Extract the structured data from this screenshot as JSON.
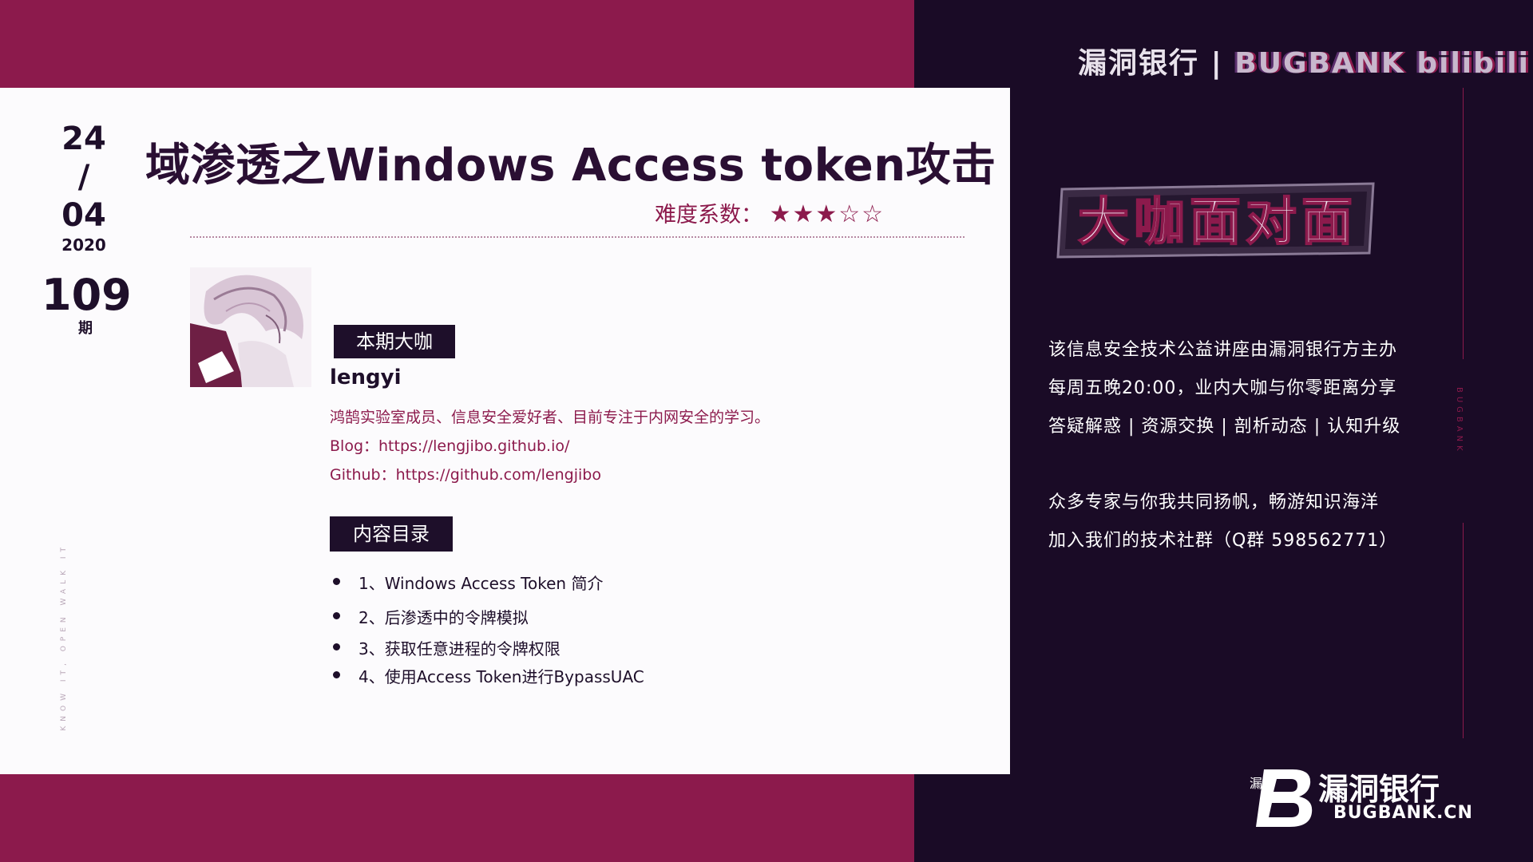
{
  "date": {
    "day": "24",
    "sep": "/",
    "month": "04",
    "year": "2020"
  },
  "issue": {
    "number": "109",
    "suffix": "期"
  },
  "title": "域渗透之Windows Access token攻击",
  "difficulty": {
    "label": "难度系数：",
    "stars": "★★★☆☆",
    "rating": 3,
    "max": 5
  },
  "speaker": {
    "tag": "本期大咖",
    "name": "lengyi",
    "description": "鸿鹄实验室成员、信息安全爱好者、目前专注于内网安全的学习。",
    "blog": "Blog：https://lengjibo.github.io/",
    "github": "Github：https://github.com/lengjibo"
  },
  "toc": {
    "tag": "内容目录",
    "items": [
      "1、Windows Access Token 简介",
      "2、后渗透中的令牌模拟",
      "3、获取任意进程的令牌权限",
      "4、使用Access Token进行BypassUAC"
    ]
  },
  "side_vertical_text": "KNOW IT, OPEN WALK IT",
  "header": {
    "brand_cn": "漏洞银行",
    "divider": "|",
    "brand_en": "BUGBANK",
    "extra": "bilibili"
  },
  "logo_text": "大咖面对面",
  "vertical_brand": "BUGBANK",
  "promo": {
    "line1": "该信息安全技术公益讲座由漏洞银行方主办",
    "line2": "每周五晚20:00，业内大咖与你零距离分享",
    "line3": "答疑解惑 | 资源交换 | 剖析动态 | 认知升级",
    "line4": "众多专家与你我共同扬帆，畅游知识海洋",
    "line5": "加入我们的技术社群（Q群 598562771）"
  },
  "footer": {
    "tiny": "漏",
    "cn": "漏洞银行",
    "en": "BUGBANK.CN"
  },
  "colors": {
    "maroon": "#8c1a4c",
    "dark": "#1a0b26",
    "card": "#fcfbfd",
    "navy_text": "#1e0f2a"
  }
}
